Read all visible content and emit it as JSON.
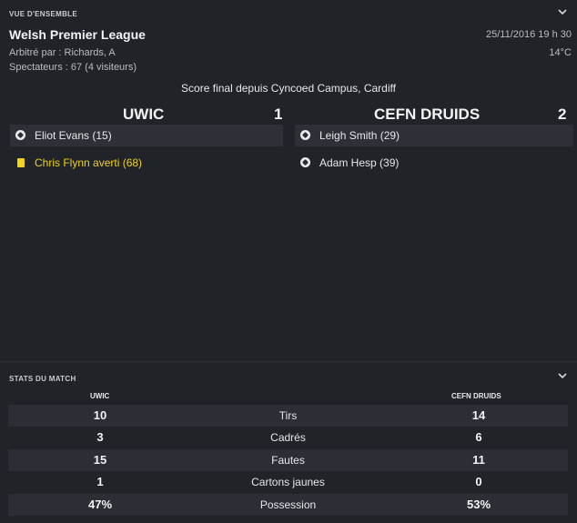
{
  "overview": {
    "section_label": "VUE D'ENSEMBLE",
    "competition": "Welsh Premier League",
    "datetime": "25/11/2016 19 h 30",
    "referee": "Arbitré par : Richards, A",
    "temperature": "14°C",
    "spectators": "Spectateurs : 67 (4 visiteurs)",
    "final_score_text": "Score final depuis Cyncoed Campus, Cardiff",
    "home": {
      "name": "UWIC",
      "score": "1",
      "events": [
        {
          "type": "goal",
          "icon": "football-icon",
          "text": "Eliot Evans (15)"
        },
        {
          "type": "yellow-card",
          "icon": "yellow-card-icon",
          "text": "Chris Flynn averti (68)"
        }
      ]
    },
    "away": {
      "name": "CEFN DRUIDS",
      "score": "2",
      "events": [
        {
          "type": "goal",
          "icon": "football-icon",
          "text": "Leigh Smith (29)"
        },
        {
          "type": "goal",
          "icon": "football-icon",
          "text": "Adam Hesp (39)"
        }
      ]
    }
  },
  "stats": {
    "section_label": "STATS DU MATCH",
    "home_header": "UWIC",
    "away_header": "CEFN DRUIDS",
    "rows": [
      {
        "label": "Tirs",
        "home": "10",
        "away": "14"
      },
      {
        "label": "Cadrés",
        "home": "3",
        "away": "6"
      },
      {
        "label": "Fautes",
        "home": "15",
        "away": "11"
      },
      {
        "label": "Cartons jaunes",
        "home": "1",
        "away": "0"
      },
      {
        "label": "Possession",
        "home": "47%",
        "away": "53%"
      }
    ]
  },
  "colors": {
    "background": "#202328",
    "row_alt": "#2b2f35",
    "yellow_card": "#f1d21d"
  }
}
